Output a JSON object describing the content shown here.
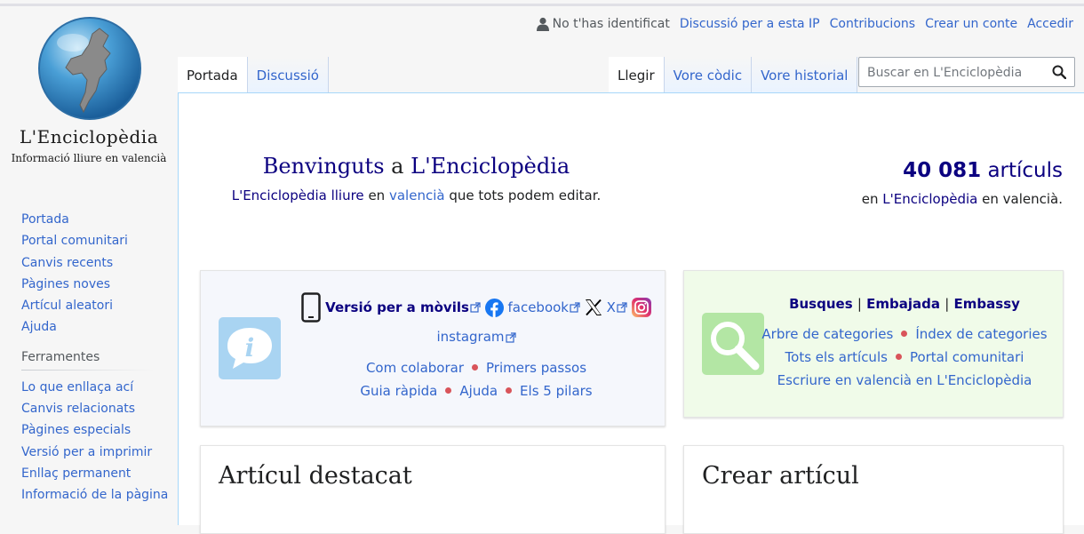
{
  "logo": {
    "title": "L'Enciclopèdia",
    "subtitle": "Informació lliure en valencià"
  },
  "sidebar": {
    "navigation": [
      "Portada",
      "Portal comunitari",
      "Canvis recents",
      "Pàgines noves",
      "Artícul aleatori",
      "Ajuda"
    ],
    "tools_heading": "Ferramentes",
    "tools": [
      "Lo que enllaça ací",
      "Canvis relacionats",
      "Pàgines especials",
      "Versió per a imprimir",
      "Enllaç permanent",
      "Informació de la pàgina"
    ]
  },
  "user": {
    "anon": "No t'has identificat",
    "links": [
      "Discussió per a esta IP",
      "Contribucions",
      "Crear un conte",
      "Accedir"
    ]
  },
  "tabs": {
    "left": [
      {
        "label": "Portada",
        "selected": true
      },
      {
        "label": "Discussió",
        "selected": false
      }
    ],
    "right": [
      {
        "label": "Llegir",
        "selected": true
      },
      {
        "label": "Vore còdic",
        "selected": false
      },
      {
        "label": "Vore historial",
        "selected": false
      }
    ]
  },
  "search": {
    "placeholder": "Buscar en L'Enciclopèdia"
  },
  "welcome": {
    "title_a": "Benvinguts",
    "title_b": "a",
    "title_c": "L'Enciclopèdia",
    "sub_a": "L'Enciclopèdia lliure",
    "sub_b": "en",
    "sub_c": "valencià",
    "sub_d": "que tots podem editar."
  },
  "stats": {
    "count": "40 081",
    "unit": "artículs",
    "sub_a": "en",
    "sub_b": "L'Enciclopèdia",
    "sub_c": "en valencià."
  },
  "info_box": {
    "mobile": "Versió per a mòvils",
    "facebook": "facebook",
    "x": "X",
    "instagram": "instagram",
    "row1": [
      "Com colaborar",
      "Primers passos"
    ],
    "row2": [
      "Guia ràpida",
      "Ajuda",
      "Els 5 pilars"
    ]
  },
  "search_box": {
    "header": [
      "Busques",
      "Embajada",
      "Embassy"
    ],
    "row1": [
      "Arbre de categories",
      "Índex de categories"
    ],
    "row2": [
      "Tots els artículs",
      "Portal comunitari"
    ],
    "row3": "Escriure en valencià en L'Enciclopèdia"
  },
  "featured": {
    "title": "Artícul destacat"
  },
  "create": {
    "title": "Crear artícul"
  },
  "colors": {
    "link": "#3366cc",
    "navy": "#0b0080",
    "dot": "#d9545a",
    "info_bg": "#f5f7fc",
    "search_bg": "#f0fbe9"
  }
}
